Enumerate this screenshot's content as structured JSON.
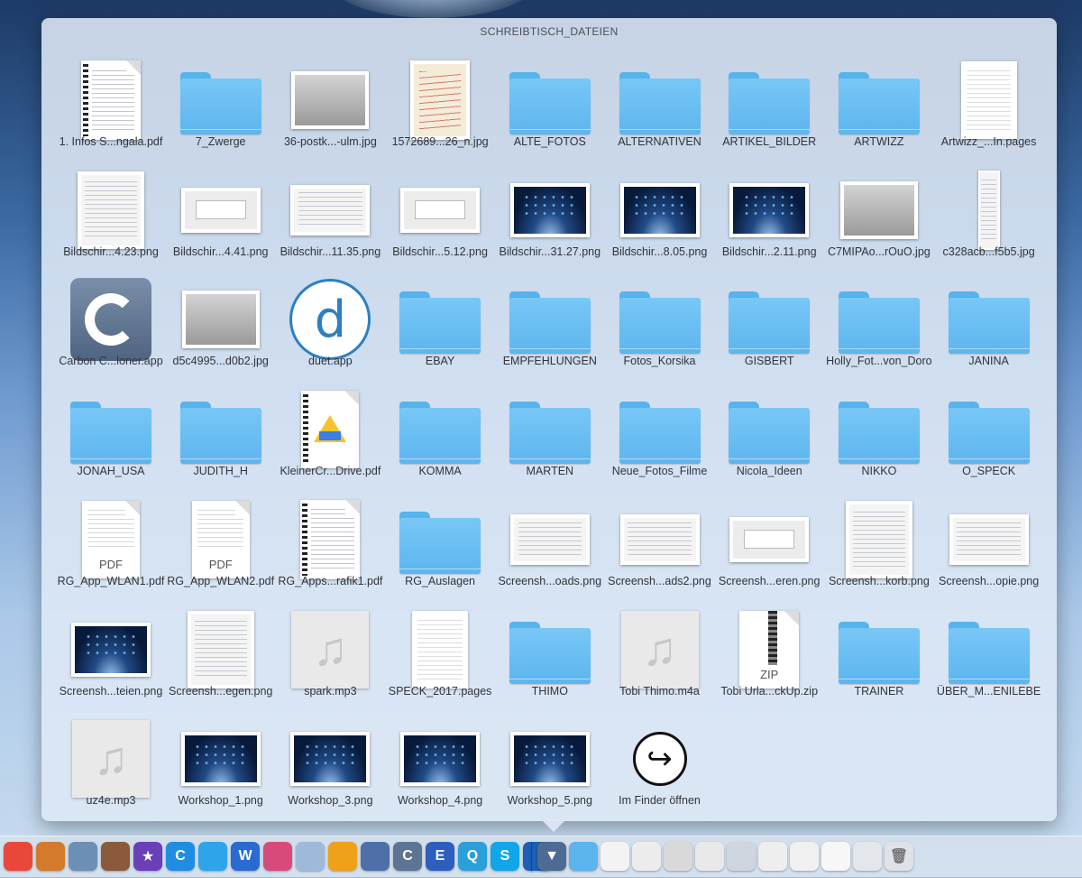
{
  "stack": {
    "title": "SCHREIBTISCH_DATEIEN",
    "items": [
      {
        "label": "1. Infos S...ngala.pdf",
        "icon": "spiral-document-icon"
      },
      {
        "label": "7_Zwerge",
        "icon": "folder-icon"
      },
      {
        "label": "36-postk...-ulm.jpg",
        "icon": "photo-thumbnail-icon"
      },
      {
        "label": "1572689...26_n.jpg",
        "icon": "handwritten-note-icon"
      },
      {
        "label": "ALTE_FOTOS",
        "icon": "folder-icon"
      },
      {
        "label": "ALTERNATIVEN",
        "icon": "folder-icon"
      },
      {
        "label": "ARTIKEL_BILDER",
        "icon": "folder-icon"
      },
      {
        "label": "ARTWIZZ",
        "icon": "folder-icon"
      },
      {
        "label": "Artwizz_...In.pages",
        "icon": "pages-document-icon"
      },
      {
        "label": "Bildschir...4.23.png",
        "icon": "menu-screenshot-icon"
      },
      {
        "label": "Bildschir...4.41.png",
        "icon": "dialog-screenshot-icon"
      },
      {
        "label": "Bildschir...11.35.png",
        "icon": "window-screenshot-icon"
      },
      {
        "label": "Bildschir...5.12.png",
        "icon": "dialog-screenshot-icon"
      },
      {
        "label": "Bildschir...31.27.png",
        "icon": "desktop-screenshot-icon"
      },
      {
        "label": "Bildschir...8.05.png",
        "icon": "desktop-screenshot-icon"
      },
      {
        "label": "Bildschir...2.11.png",
        "icon": "desktop-screenshot-icon"
      },
      {
        "label": "C7MIPAo...rOuO.jpg",
        "icon": "photo-thumbnail-icon"
      },
      {
        "label": "c328acb...f5b5.jpg",
        "icon": "tall-image-icon"
      },
      {
        "label": "Carbon C...loner.app",
        "icon": "carbon-copy-cloner-app-icon"
      },
      {
        "label": "d5c4995...d0b2.jpg",
        "icon": "photo-thumbnail-icon"
      },
      {
        "label": "duet.app",
        "icon": "duet-app-icon"
      },
      {
        "label": "EBAY",
        "icon": "folder-icon"
      },
      {
        "label": "EMPFEHLUNGEN",
        "icon": "folder-icon"
      },
      {
        "label": "Fotos_Korsika",
        "icon": "folder-icon"
      },
      {
        "label": "GISBERT",
        "icon": "folder-icon"
      },
      {
        "label": "Holly_Fot...von_Doro",
        "icon": "folder-icon"
      },
      {
        "label": "JANINA",
        "icon": "folder-icon"
      },
      {
        "label": "JONAH_USA",
        "icon": "folder-icon"
      },
      {
        "label": "JUDITH_H",
        "icon": "folder-icon"
      },
      {
        "label": "KleinerCr...Drive.pdf",
        "icon": "google-drive-pdf-icon"
      },
      {
        "label": "KOMMA",
        "icon": "folder-icon"
      },
      {
        "label": "MARTEN",
        "icon": "folder-icon"
      },
      {
        "label": "Neue_Fotos_Filme",
        "icon": "folder-icon"
      },
      {
        "label": "Nicola_Ideen",
        "icon": "folder-icon"
      },
      {
        "label": "NIKKO",
        "icon": "folder-icon"
      },
      {
        "label": "O_SPECK",
        "icon": "folder-icon"
      },
      {
        "label": "RG_App_WLAN1.pdf",
        "icon": "pdf-document-icon"
      },
      {
        "label": "RG_App_WLAN2.pdf",
        "icon": "pdf-document-icon"
      },
      {
        "label": "RG_Apps...rafik1.pdf",
        "icon": "spiral-document-icon"
      },
      {
        "label": "RG_Auslagen",
        "icon": "folder-icon"
      },
      {
        "label": "Screensh...oads.png",
        "icon": "window-screenshot-icon"
      },
      {
        "label": "Screensh...ads2.png",
        "icon": "window-screenshot-icon"
      },
      {
        "label": "Screensh...eren.png",
        "icon": "dialog-screenshot-icon"
      },
      {
        "label": "Screensh...korb.png",
        "icon": "menu-screenshot-icon"
      },
      {
        "label": "Screensh...opie.png",
        "icon": "window-screenshot-icon"
      },
      {
        "label": "Screensh...teien.png",
        "icon": "desktop-screenshot-icon"
      },
      {
        "label": "Screensh...egen.png",
        "icon": "menu-screenshot-icon"
      },
      {
        "label": "spark.mp3",
        "icon": "music-file-icon"
      },
      {
        "label": "SPECK_2017.pages",
        "icon": "pages-document-icon"
      },
      {
        "label": "THIMO",
        "icon": "folder-icon"
      },
      {
        "label": "Tobi Thimo.m4a",
        "icon": "music-file-icon"
      },
      {
        "label": "Tobi Urla...ckUp.zip",
        "icon": "zip-file-icon"
      },
      {
        "label": "TRAINER",
        "icon": "folder-icon"
      },
      {
        "label": "ÜBER_M...ENILEBE",
        "icon": "folder-icon"
      },
      {
        "label": "uz4e.mp3",
        "icon": "music-file-icon"
      },
      {
        "label": "Workshop_1.png",
        "icon": "desktop-screenshot-icon"
      },
      {
        "label": "Workshop_3.png",
        "icon": "desktop-screenshot-icon"
      },
      {
        "label": "Workshop_4.png",
        "icon": "desktop-screenshot-icon"
      },
      {
        "label": "Workshop_5.png",
        "icon": "desktop-screenshot-icon"
      },
      {
        "label": "Im Finder öffnen",
        "icon": "open-in-finder-icon"
      }
    ],
    "file_type_badges": {
      "pdf": "PDF",
      "zip": "ZIP"
    }
  },
  "dock": {
    "apps": [
      {
        "icon": "calendar-app-icon",
        "color": "#e8483a",
        "glyph": ""
      },
      {
        "icon": "calculator-app-icon",
        "color": "#d37a2c",
        "glyph": ""
      },
      {
        "icon": "preview-app-icon",
        "color": "#6d8fb5",
        "glyph": ""
      },
      {
        "icon": "basketball-app-icon",
        "color": "#8a5a3a",
        "glyph": ""
      },
      {
        "icon": "imovie-app-icon",
        "color": "#6a3fb8",
        "glyph": "★"
      },
      {
        "icon": "ccleaner-app-icon",
        "color": "#1f8de0",
        "glyph": "C"
      },
      {
        "icon": "twitter-app-icon",
        "color": "#2ea5ea",
        "glyph": ""
      },
      {
        "icon": "word-app-icon",
        "color": "#2b6bd1",
        "glyph": "W"
      },
      {
        "icon": "display-app-icon",
        "color": "#d84a7a",
        "glyph": ""
      },
      {
        "icon": "balloon-app-icon",
        "color": "#9fb9d8",
        "glyph": ""
      },
      {
        "icon": "audio-app-icon",
        "color": "#f0a11a",
        "glyph": ""
      },
      {
        "icon": "pixelmator-app-icon",
        "color": "#4e6fa7",
        "glyph": ""
      },
      {
        "icon": "carbon-copy-cloner-dock-icon",
        "color": "#5d7594",
        "glyph": "C"
      },
      {
        "icon": "e-app-icon",
        "color": "#2e5fbf",
        "glyph": "E"
      },
      {
        "icon": "q-app-icon",
        "color": "#2b9fd9",
        "glyph": "Q"
      },
      {
        "icon": "skype-app-icon",
        "color": "#11a6ea",
        "glyph": "S"
      },
      {
        "icon": "remote-desktop-app-icon",
        "color": "#1c5fb4",
        "glyph": ""
      }
    ]
  }
}
